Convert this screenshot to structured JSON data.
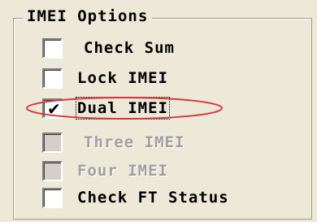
{
  "group": {
    "title": "IMEI Options"
  },
  "options": [
    {
      "label": "Check Sum",
      "checked": false,
      "enabled": true
    },
    {
      "label": "Lock IMEI",
      "checked": false,
      "enabled": true
    },
    {
      "label": "Dual IMEI",
      "checked": true,
      "enabled": true,
      "focused": true,
      "glyph": "✔"
    },
    {
      "label": "Three IMEI",
      "checked": false,
      "enabled": false
    },
    {
      "label": "Four IMEI",
      "checked": false,
      "enabled": false
    },
    {
      "label": "Check FT Status",
      "checked": false,
      "enabled": true
    }
  ],
  "colors": {
    "background": "#ece9d8",
    "annotation": "#d9363e",
    "disabled_text": "#a0a0a0"
  }
}
